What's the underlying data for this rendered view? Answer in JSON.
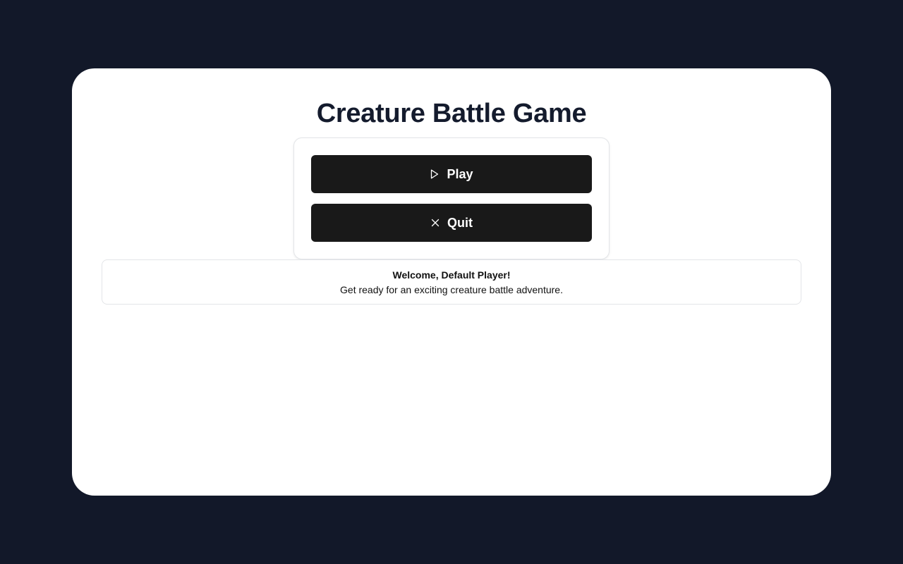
{
  "app": {
    "title": "Creature Battle Game"
  },
  "menu": {
    "play": {
      "label": "Play",
      "icon": "play-icon"
    },
    "quit": {
      "label": "Quit",
      "icon": "close-icon"
    }
  },
  "welcome": {
    "heading": "Welcome, Default Player!",
    "message": "Get ready for an exciting creature battle adventure."
  },
  "colors": {
    "background": "#121829",
    "card": "#ffffff",
    "title": "#141b2d",
    "button": "#191919",
    "button_text": "#ffffff",
    "border": "#e3e5e8"
  }
}
